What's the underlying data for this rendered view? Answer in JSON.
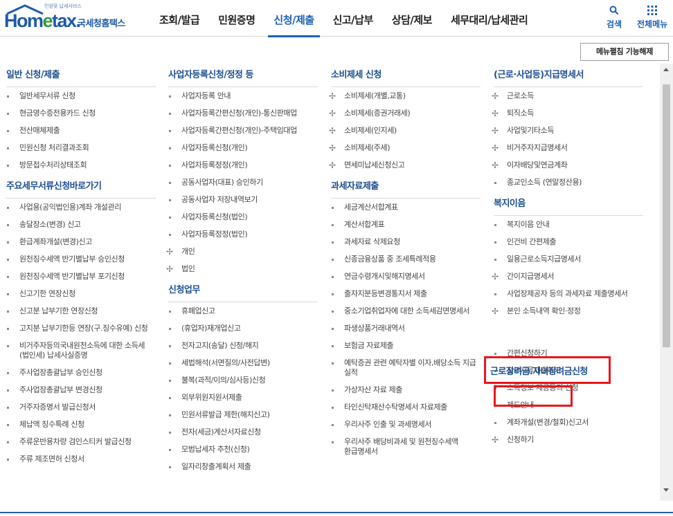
{
  "logo": {
    "tagline": "민원맞 납세서비스",
    "brand_pre": "Hom",
    "brand_e": "e",
    "brand_post": "tax.",
    "sub": "국세청홈택스"
  },
  "nav": [
    {
      "label": "조회/발급"
    },
    {
      "label": "민원증명"
    },
    {
      "label": "신청/제출",
      "active": true
    },
    {
      "label": "신고/납부"
    },
    {
      "label": "상담/제보"
    },
    {
      "label": "세무대리/납세관리"
    }
  ],
  "header_buttons": {
    "search": "검색",
    "all_menu": "전체메뉴"
  },
  "collapse_button": "메뉴펼침 기능해제",
  "columns": [
    [
      {
        "title": "일반 신청/제출",
        "items": [
          {
            "label": "일반세무서류 신청",
            "marker": "b"
          },
          {
            "label": "현금영수증전용카드 신청",
            "marker": "b"
          },
          {
            "label": "전산매체제출",
            "marker": "b"
          },
          {
            "label": "민원신청 처리결과조회",
            "marker": "b"
          },
          {
            "label": "방문접수처리상태조회",
            "marker": "b"
          }
        ]
      },
      {
        "title": "주요세무서류신청바로가기",
        "items": [
          {
            "label": "사업용(공익법인용)계좌 개설관리",
            "marker": "b"
          },
          {
            "label": "송달장소(변경) 신고",
            "marker": "b"
          },
          {
            "label": "환급계좌개설(변경)신고",
            "marker": "b"
          },
          {
            "label": "원천징수세액 반기별납부 승인신청",
            "marker": "b"
          },
          {
            "label": "원천징수세액 반기별납부 포기신청",
            "marker": "b"
          },
          {
            "label": "신고기한 연장신청",
            "marker": "b"
          },
          {
            "label": "신고분 납부기한 연장신청",
            "marker": "b"
          },
          {
            "label": "고지분 납부기한등 연장(구.징수유예) 신청",
            "marker": "b"
          },
          {
            "label": "비거주자등의국내원천소득에 대한 소득세(법인세) 납세사실증명",
            "marker": "b"
          },
          {
            "label": "주사업장총괄납부 승인신청",
            "marker": "b"
          },
          {
            "label": "주사업장총괄납부 변경신청",
            "marker": "b"
          },
          {
            "label": "거주자증명서 발급신청서",
            "marker": "b"
          },
          {
            "label": "체납액 징수특례 신청",
            "marker": "b"
          },
          {
            "label": "주류운반용차량 검인스티커 발급신청",
            "marker": "b"
          },
          {
            "label": "주류 제조면허 신청서",
            "marker": "b"
          }
        ]
      }
    ],
    [
      {
        "title": "사업자등록신청/정정 등",
        "items": [
          {
            "label": "사업자등록 안내",
            "marker": "b"
          },
          {
            "label": "사업자등록간편신청(개인)-통신판매업",
            "marker": "b"
          },
          {
            "label": "사업자등록간편신청(개인)-주택임대업",
            "marker": "b"
          },
          {
            "label": "사업자등록신청(개인)",
            "marker": "b"
          },
          {
            "label": "사업자등록정정(개인)",
            "marker": "b"
          },
          {
            "label": "공동사업자(대표) 승인하기",
            "marker": "b"
          },
          {
            "label": "공동사업자 저장내역보기",
            "marker": "b"
          },
          {
            "label": "사업자등록신청(법인)",
            "marker": "b"
          },
          {
            "label": "사업자등록정정(법인)",
            "marker": "b"
          },
          {
            "label": "개인",
            "marker": "p"
          },
          {
            "label": "법인",
            "marker": "p"
          }
        ]
      },
      {
        "title": "신청업무",
        "items": [
          {
            "label": "휴폐업신고",
            "marker": "b"
          },
          {
            "label": "(휴업자)재개업신고",
            "marker": "b"
          },
          {
            "label": "전자고지(송달) 신청/해지",
            "marker": "b"
          },
          {
            "label": "세법해석(서면질의/사전답변)",
            "marker": "b"
          },
          {
            "label": "불복(과적/이의/심사등)신청",
            "marker": "b"
          },
          {
            "label": "외부위원지원서제출",
            "marker": "b"
          },
          {
            "label": "민원서류발급 제한(해지신고)",
            "marker": "b"
          },
          {
            "label": "전자(세금)계산서자료신청",
            "marker": "b"
          },
          {
            "label": "모범납세자 추천(신청)",
            "marker": "b"
          },
          {
            "label": "일자리창출계획서 제출",
            "marker": "b"
          }
        ]
      }
    ],
    [
      {
        "title": "소비제세 신청",
        "items": [
          {
            "label": "소비제세(개별,교통)",
            "marker": "p"
          },
          {
            "label": "소비제세(증권거래세)",
            "marker": "p"
          },
          {
            "label": "소비제세(인지세)",
            "marker": "p"
          },
          {
            "label": "소비제세(주세)",
            "marker": "p"
          },
          {
            "label": "면세미납세신청신고",
            "marker": "p"
          }
        ]
      },
      {
        "title": "과세자료제출",
        "items": [
          {
            "label": "세금계산서합계표",
            "marker": "b"
          },
          {
            "label": "계산서합계표",
            "marker": "b"
          },
          {
            "label": "과세자료 삭제요청",
            "marker": "b"
          },
          {
            "label": "신종금융상품 중 조세특례적용",
            "marker": "b"
          },
          {
            "label": "연금수령개시및해지명세서",
            "marker": "b"
          },
          {
            "label": "출자지분등변경통지서 제출",
            "marker": "b"
          },
          {
            "label": "중소기업취업자에 대한 소득세감면명세서",
            "marker": "b"
          },
          {
            "label": "파생상품거래내역서",
            "marker": "b"
          },
          {
            "label": "보험금 자료제출",
            "marker": "b"
          },
          {
            "label": "예탁증권 관련 예탁자별 이자,배당소득 지급 실적",
            "marker": "b"
          },
          {
            "label": "가상자산 자료 제출",
            "marker": "b"
          },
          {
            "label": "타인신탁재산수탁명세서 자료제출",
            "marker": "b"
          },
          {
            "label": "우리사주 인출 및 과세명세서",
            "marker": "b"
          },
          {
            "label": "우리사주 배당비과세 및 원천징수세액 환급명세서",
            "marker": "b"
          }
        ]
      }
    ],
    [
      {
        "title": "(근로·사업등)지급명세서",
        "items": [
          {
            "label": "근로소득",
            "marker": "p"
          },
          {
            "label": "퇴직소득",
            "marker": "p"
          },
          {
            "label": "사업및기타소득",
            "marker": "p"
          },
          {
            "label": "비거주자지급명세서",
            "marker": "p"
          },
          {
            "label": "이자배당및연금계좌",
            "marker": "p"
          },
          {
            "label": "종교인소득 (연말정산용)",
            "marker": "b"
          }
        ]
      },
      {
        "title": "복지이음",
        "items": [
          {
            "label": "복지이음 안내",
            "marker": "b"
          },
          {
            "label": "인건비 간편제출",
            "marker": "b"
          },
          {
            "label": "일용근로소득지급명세서",
            "marker": "b"
          },
          {
            "label": "간이지급명세서",
            "marker": "p"
          },
          {
            "label": "사업장제공자 등의 과세자료 제출명세서",
            "marker": "b"
          },
          {
            "label": "본인 소득내역 확인·정정",
            "marker": "p"
          }
        ]
      },
      {
        "title": "근로장려금.자녀장려금신청",
        "highlight": true,
        "items": [
          {
            "label": "간편신청하기",
            "marker": "b"
          },
          {
            "label": "첨부서류제출하기",
            "marker": "b"
          },
          {
            "label": "소득정보 제공동의 신청",
            "marker": "b"
          },
          {
            "label": "제도안내",
            "marker": "b"
          },
          {
            "label": "계좌개설(변경/철회)신고서",
            "marker": "b"
          },
          {
            "label": "신청하기",
            "marker": "p"
          }
        ]
      }
    ]
  ],
  "colors": {
    "brand_blue": "#1d5fb6",
    "title_blue": "#1d4f91",
    "highlight_red": "#e8161b"
  }
}
